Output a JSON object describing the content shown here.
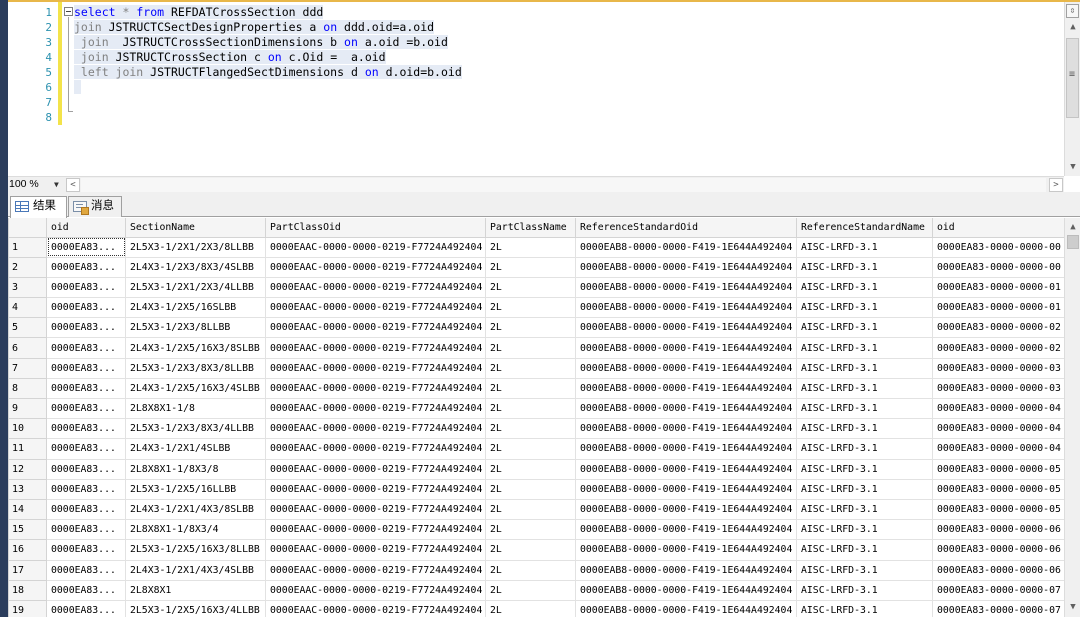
{
  "editor": {
    "line_numbers": [
      "1",
      "2",
      "3",
      "4",
      "5",
      "6",
      "7",
      "8"
    ],
    "lines": [
      [
        {
          "t": "select",
          "c": "kw"
        },
        {
          "t": " "
        },
        {
          "t": "*",
          "c": "gr"
        },
        {
          "t": " "
        },
        {
          "t": "from",
          "c": "kw"
        },
        {
          "t": " REFDATCrossSection ddd"
        }
      ],
      [
        {
          "t": "join",
          "c": "gr"
        },
        {
          "t": " JSTRUCTCSectDesignProperties a "
        },
        {
          "t": "on",
          "c": "kw"
        },
        {
          "t": " ddd.oid=a.oid"
        }
      ],
      [
        {
          "t": " join",
          "c": "gr"
        },
        {
          "t": "  JSTRUCTCrossSectionDimensions b "
        },
        {
          "t": "on",
          "c": "kw"
        },
        {
          "t": " a.oid =b.oid"
        }
      ],
      [
        {
          "t": " join",
          "c": "gr"
        },
        {
          "t": " JSTRUCTCrossSection c "
        },
        {
          "t": "on",
          "c": "kw"
        },
        {
          "t": " c.Oid =  a.oid"
        }
      ],
      [
        {
          "t": " left join",
          "c": "gr"
        },
        {
          "t": " JSTRUCTFlangedSectDimensions d "
        },
        {
          "t": "on",
          "c": "kw"
        },
        {
          "t": " d.oid=b.oid"
        }
      ],
      [
        {
          "t": " "
        }
      ],
      [
        {
          "t": ""
        }
      ],
      [
        {
          "t": ""
        }
      ]
    ]
  },
  "zoom": {
    "label": "100 %"
  },
  "tabs": [
    {
      "label": "结果",
      "icon": "grid-icon",
      "active": true
    },
    {
      "label": "消息",
      "icon": "message-icon",
      "active": false
    }
  ],
  "grid": {
    "columns": [
      "oid",
      "SectionName",
      "PartClassOid",
      "PartClassName",
      "ReferenceStandardOid",
      "ReferenceStandardName",
      "oid"
    ],
    "rows": [
      [
        "1",
        "0000EA83...",
        "2L5X3-1/2X1/2X3/8LLBB",
        "0000EAAC-0000-0000-0219-F7724A492404",
        "2L",
        "0000EAB8-0000-0000-F419-1E644A492404",
        "AISC-LRFD-3.1",
        "0000EA83-0000-0000-00"
      ],
      [
        "2",
        "0000EA83...",
        "2L4X3-1/2X3/8X3/4SLBB",
        "0000EAAC-0000-0000-0219-F7724A492404",
        "2L",
        "0000EAB8-0000-0000-F419-1E644A492404",
        "AISC-LRFD-3.1",
        "0000EA83-0000-0000-00"
      ],
      [
        "3",
        "0000EA83...",
        "2L5X3-1/2X1/2X3/4LLBB",
        "0000EAAC-0000-0000-0219-F7724A492404",
        "2L",
        "0000EAB8-0000-0000-F419-1E644A492404",
        "AISC-LRFD-3.1",
        "0000EA83-0000-0000-01"
      ],
      [
        "4",
        "0000EA83...",
        "2L4X3-1/2X5/16SLBB",
        "0000EAAC-0000-0000-0219-F7724A492404",
        "2L",
        "0000EAB8-0000-0000-F419-1E644A492404",
        "AISC-LRFD-3.1",
        "0000EA83-0000-0000-01"
      ],
      [
        "5",
        "0000EA83...",
        "2L5X3-1/2X3/8LLBB",
        "0000EAAC-0000-0000-0219-F7724A492404",
        "2L",
        "0000EAB8-0000-0000-F419-1E644A492404",
        "AISC-LRFD-3.1",
        "0000EA83-0000-0000-02"
      ],
      [
        "6",
        "0000EA83...",
        "2L4X3-1/2X5/16X3/8SLBB",
        "0000EAAC-0000-0000-0219-F7724A492404",
        "2L",
        "0000EAB8-0000-0000-F419-1E644A492404",
        "AISC-LRFD-3.1",
        "0000EA83-0000-0000-02"
      ],
      [
        "7",
        "0000EA83...",
        "2L5X3-1/2X3/8X3/8LLBB",
        "0000EAAC-0000-0000-0219-F7724A492404",
        "2L",
        "0000EAB8-0000-0000-F419-1E644A492404",
        "AISC-LRFD-3.1",
        "0000EA83-0000-0000-03"
      ],
      [
        "8",
        "0000EA83...",
        "2L4X3-1/2X5/16X3/4SLBB",
        "0000EAAC-0000-0000-0219-F7724A492404",
        "2L",
        "0000EAB8-0000-0000-F419-1E644A492404",
        "AISC-LRFD-3.1",
        "0000EA83-0000-0000-03"
      ],
      [
        "9",
        "0000EA83...",
        "2L8X8X1-1/8",
        "0000EAAC-0000-0000-0219-F7724A492404",
        "2L",
        "0000EAB8-0000-0000-F419-1E644A492404",
        "AISC-LRFD-3.1",
        "0000EA83-0000-0000-04"
      ],
      [
        "10",
        "0000EA83...",
        "2L5X3-1/2X3/8X3/4LLBB",
        "0000EAAC-0000-0000-0219-F7724A492404",
        "2L",
        "0000EAB8-0000-0000-F419-1E644A492404",
        "AISC-LRFD-3.1",
        "0000EA83-0000-0000-04"
      ],
      [
        "11",
        "0000EA83...",
        "2L4X3-1/2X1/4SLBB",
        "0000EAAC-0000-0000-0219-F7724A492404",
        "2L",
        "0000EAB8-0000-0000-F419-1E644A492404",
        "AISC-LRFD-3.1",
        "0000EA83-0000-0000-04"
      ],
      [
        "12",
        "0000EA83...",
        "2L8X8X1-1/8X3/8",
        "0000EAAC-0000-0000-0219-F7724A492404",
        "2L",
        "0000EAB8-0000-0000-F419-1E644A492404",
        "AISC-LRFD-3.1",
        "0000EA83-0000-0000-05"
      ],
      [
        "13",
        "0000EA83...",
        "2L5X3-1/2X5/16LLBB",
        "0000EAAC-0000-0000-0219-F7724A492404",
        "2L",
        "0000EAB8-0000-0000-F419-1E644A492404",
        "AISC-LRFD-3.1",
        "0000EA83-0000-0000-05"
      ],
      [
        "14",
        "0000EA83...",
        "2L4X3-1/2X1/4X3/8SLBB",
        "0000EAAC-0000-0000-0219-F7724A492404",
        "2L",
        "0000EAB8-0000-0000-F419-1E644A492404",
        "AISC-LRFD-3.1",
        "0000EA83-0000-0000-05"
      ],
      [
        "15",
        "0000EA83...",
        "2L8X8X1-1/8X3/4",
        "0000EAAC-0000-0000-0219-F7724A492404",
        "2L",
        "0000EAB8-0000-0000-F419-1E644A492404",
        "AISC-LRFD-3.1",
        "0000EA83-0000-0000-06"
      ],
      [
        "16",
        "0000EA83...",
        "2L5X3-1/2X5/16X3/8LLBB",
        "0000EAAC-0000-0000-0219-F7724A492404",
        "2L",
        "0000EAB8-0000-0000-F419-1E644A492404",
        "AISC-LRFD-3.1",
        "0000EA83-0000-0000-06"
      ],
      [
        "17",
        "0000EA83...",
        "2L4X3-1/2X1/4X3/4SLBB",
        "0000EAAC-0000-0000-0219-F7724A492404",
        "2L",
        "0000EAB8-0000-0000-F419-1E644A492404",
        "AISC-LRFD-3.1",
        "0000EA83-0000-0000-06"
      ],
      [
        "18",
        "0000EA83...",
        "2L8X8X1",
        "0000EAAC-0000-0000-0219-F7724A492404",
        "2L",
        "0000EAB8-0000-0000-F419-1E644A492404",
        "AISC-LRFD-3.1",
        "0000EA83-0000-0000-07"
      ],
      [
        "19",
        "0000EA83...",
        "2L5X3-1/2X5/16X3/4LLBB",
        "0000EAAC-0000-0000-0219-F7724A492404",
        "2L",
        "0000EAB8-0000-0000-F419-1E644A492404",
        "AISC-LRFD-3.1",
        "0000EA83-0000-0000-07"
      ]
    ]
  },
  "colors": {
    "keyword": "#0000ff",
    "operator": "#808080",
    "line_number": "#2b91af",
    "change_bar": "#f3e34a"
  }
}
